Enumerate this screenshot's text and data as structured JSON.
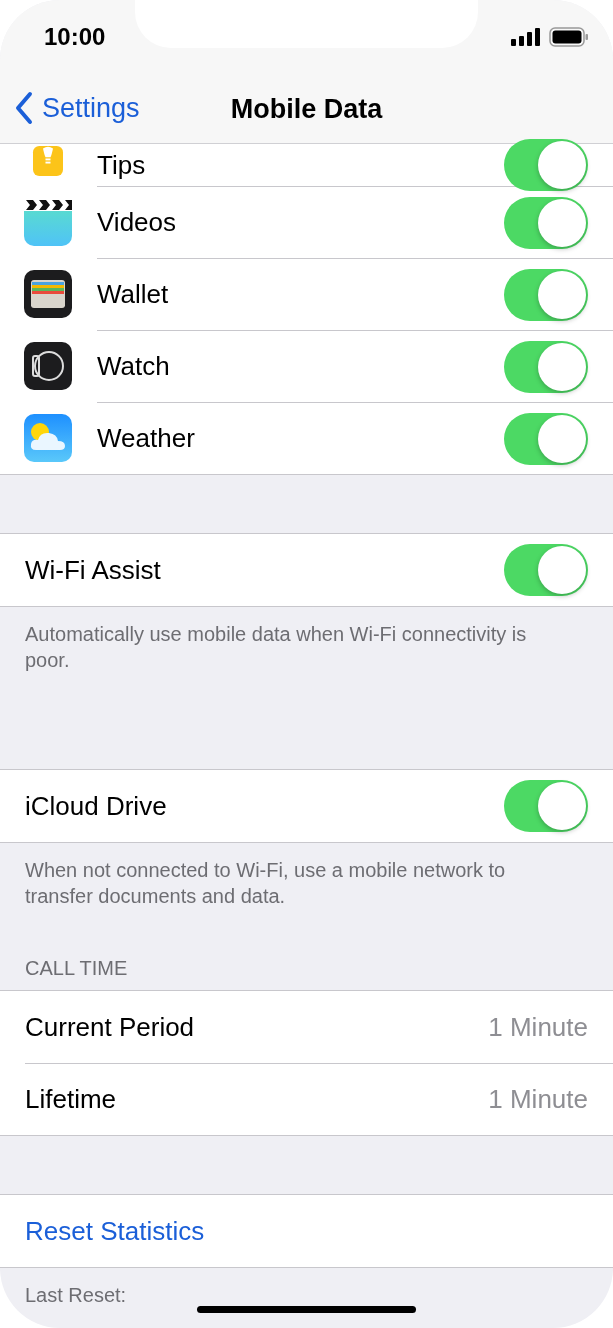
{
  "status_bar": {
    "time": "10:00"
  },
  "nav": {
    "back": "Settings",
    "title": "Mobile Data"
  },
  "apps": [
    {
      "kind": "tips",
      "name": "Tips",
      "on": true
    },
    {
      "kind": "videos",
      "name": "Videos",
      "on": true
    },
    {
      "kind": "wallet",
      "name": "Wallet",
      "on": true
    },
    {
      "kind": "watch",
      "name": "Watch",
      "on": true
    },
    {
      "kind": "weather",
      "name": "Weather",
      "on": true
    }
  ],
  "sections": [
    {
      "rows": [
        {
          "kind": "toggle",
          "label": "Wi-Fi Assist",
          "on": true
        }
      ],
      "footer": "Automatically use mobile data when Wi-Fi connectivity is poor."
    },
    {
      "rows": [
        {
          "kind": "toggle",
          "label": "iCloud Drive",
          "on": true
        }
      ],
      "footer": "When not connected to Wi-Fi, use a mobile network to transfer documents and data."
    },
    {
      "header": "CALL TIME",
      "rows": [
        {
          "kind": "value",
          "label": "Current Period",
          "value": "1 Minute"
        },
        {
          "kind": "value",
          "label": "Lifetime",
          "value": "1 Minute"
        }
      ]
    },
    {
      "rows": [
        {
          "kind": "link",
          "label": "Reset Statistics"
        }
      ],
      "footer": "Last Reset:"
    }
  ]
}
